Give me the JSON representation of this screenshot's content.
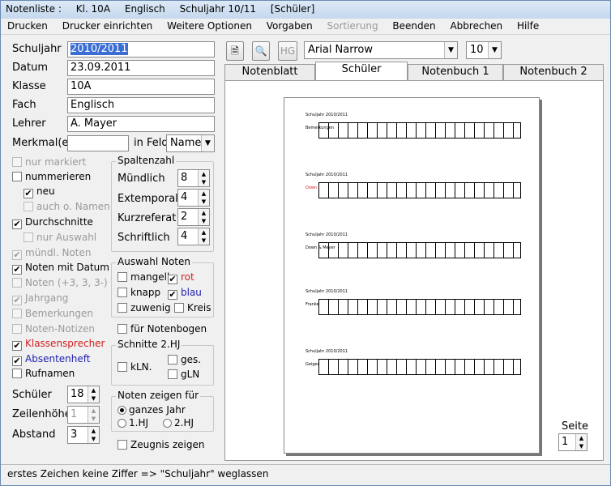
{
  "titlebar": {
    "parts": [
      "Notenliste :",
      "Kl. 10A",
      "Englisch",
      "Schuljahr 10/11",
      "[Schüler]"
    ]
  },
  "menu": [
    "Drucken",
    "Drucker einrichten",
    "Weitere Optionen",
    "Vorgaben",
    "Sortierung",
    "Beenden",
    "Abbrechen",
    "Hilfe"
  ],
  "fields": {
    "schuljahr": {
      "label": "Schuljahr",
      "value": "2010/2011"
    },
    "datum": {
      "label": "Datum",
      "value": "23.09.2011"
    },
    "klasse": {
      "label": "Klasse",
      "value": "10A"
    },
    "fach": {
      "label": "Fach",
      "value": "Englisch"
    },
    "lehrer": {
      "label": "Lehrer",
      "value": "A. Mayer"
    },
    "merkmal": {
      "label": "Merkmal(e)",
      "value": ""
    },
    "infeld": {
      "label": "in Feld",
      "value": "Name"
    }
  },
  "checks": [
    {
      "label": "nur markiert",
      "checked": false,
      "disabled": true
    },
    {
      "label": "nummerieren",
      "checked": false,
      "disabled": false
    },
    {
      "label": "neu",
      "checked": true,
      "disabled": false
    },
    {
      "label": "auch o. Namen",
      "checked": false,
      "disabled": true
    },
    {
      "label": "Durchschnitte",
      "checked": true,
      "disabled": false
    },
    {
      "label": "nur Auswahl",
      "checked": false,
      "disabled": true
    },
    {
      "label": "mündl. Noten",
      "checked": true,
      "disabled": true
    },
    {
      "label": "Noten mit Datum",
      "checked": true,
      "disabled": false
    },
    {
      "label": "Noten (+3, 3, 3-)",
      "checked": false,
      "disabled": true
    },
    {
      "label": "Jahrgang",
      "checked": true,
      "disabled": true
    },
    {
      "label": "Bemerkungen",
      "checked": false,
      "disabled": true
    },
    {
      "label": "Noten-Notizen",
      "checked": false,
      "disabled": true
    },
    {
      "label": "Klassensprecher",
      "checked": true,
      "disabled": false
    },
    {
      "label": "Absentenheft",
      "checked": true,
      "disabled": false
    },
    {
      "label": "Rufnamen",
      "checked": false,
      "disabled": false
    }
  ],
  "spinners": {
    "schueler": {
      "label": "Schüler",
      "value": "18"
    },
    "zeilenhoehe": {
      "label": "Zeilenhöhe",
      "value": "1"
    },
    "abstand": {
      "label": "Abstand",
      "value": "3"
    }
  },
  "spaltenzahl": {
    "title": "Spaltenzahl",
    "rows": [
      {
        "label": "Mündlich",
        "value": "8"
      },
      {
        "label": "Extemporale",
        "value": "4"
      },
      {
        "label": "Kurzreferat",
        "value": "2"
      },
      {
        "label": "Schriftlich",
        "value": "4"
      }
    ]
  },
  "auswahl": {
    "title": "Auswahl Noten",
    "items": [
      {
        "label": "mangelh.",
        "checked": false
      },
      {
        "label": "rot",
        "checked": true
      },
      {
        "label": "knapp",
        "checked": false
      },
      {
        "label": "blau",
        "checked": true
      },
      {
        "label": "zuwenig",
        "checked": false
      },
      {
        "label": "Kreis",
        "checked": false
      }
    ]
  },
  "notenbogen": {
    "label": "für Notenbogen",
    "checked": false
  },
  "schnitte": {
    "title": "Schnitte 2.HJ",
    "items": [
      "kLN.",
      "ges.",
      "gLN"
    ]
  },
  "zeigen": {
    "title": "Noten zeigen für",
    "options": [
      "ganzes Jahr",
      "1.HJ",
      "2.HJ"
    ]
  },
  "zeugnis": {
    "label": "Zeugnis zeigen",
    "checked": false
  },
  "toolbar": {
    "hg_label": "HG",
    "font": "Arial Narrow",
    "size": "10"
  },
  "tabs": [
    "Notenblatt",
    "Schüler",
    "Notenbuch 1",
    "Notenbuch 2"
  ],
  "seite": {
    "label": "Seite",
    "value": "1"
  },
  "preview_blocks": [
    {
      "head": "Schuljahr 2010/2011",
      "name": "Bemerkungen"
    },
    {
      "head": "Schuljahr 2010/2011",
      "name": "Down"
    },
    {
      "head": "Schuljahr 2010/2011",
      "name": "Down & Meyer"
    },
    {
      "head": "Schuljahr 2010/2011",
      "name": "Franke"
    },
    {
      "head": "Schuljahr 2010/2011",
      "name": "Geiger"
    }
  ],
  "status": "erstes Zeichen keine Ziffer => \"Schuljahr\" weglassen"
}
